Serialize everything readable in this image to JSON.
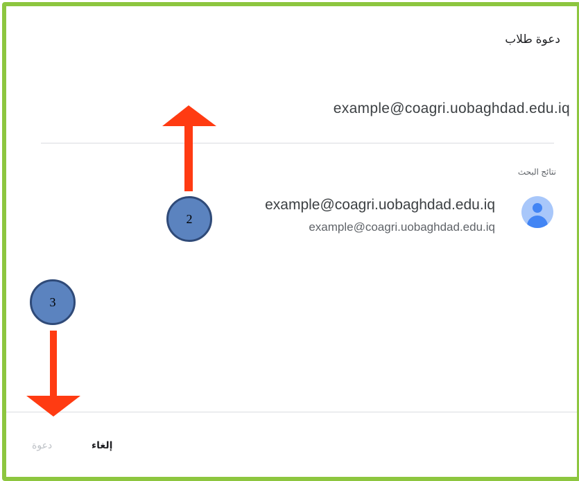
{
  "dialog": {
    "title": "دعوة طلاب",
    "search_query": "example@coagri.uobaghdad.edu.iq",
    "results_label": "نتائج البحث",
    "result": {
      "name": "example@coagri.uobaghdad.edu.iq",
      "email": "example@coagri.uobaghdad.edu.iq"
    },
    "buttons": {
      "cancel": "إلغاء",
      "invite": "دعوة"
    }
  },
  "annotations": {
    "badge_2": "2",
    "badge_3": "3"
  },
  "colors": {
    "frame": "#8dc63f",
    "arrow": "#ff3b12",
    "badge": "#5b83bf",
    "avatar_bg": "#a8c7fa",
    "avatar_fg": "#4285f4"
  }
}
